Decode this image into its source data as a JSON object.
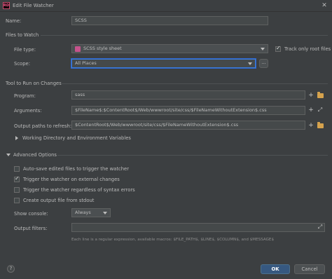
{
  "window": {
    "title": "Edit File Watcher",
    "app_icon_text": "RD"
  },
  "name": {
    "label": "Name:",
    "value": "SCSS"
  },
  "files_to_watch": {
    "section": "Files to Watch",
    "file_type_label": "File type:",
    "file_type_value": "SCSS style sheet",
    "track_only_root": {
      "label": "Track only root files",
      "checked": true
    },
    "scope_label": "Scope:",
    "scope_value": "All Places",
    "scope_more": "..."
  },
  "tool": {
    "section": "Tool to Run on Changes",
    "program_label": "Program:",
    "program_value": "sass",
    "arguments_label": "Arguments:",
    "arguments_value": "$FileName$:$ContentRoot$/Web/wwwroot/site/css/$FileNameWithoutExtension$.css",
    "output_label": "Output paths to refresh:",
    "output_value": "$ContentRoot$/Web/wwwroot/site/css/$FileNameWithoutExtension$.css",
    "working_dir_label": "Working Directory and Environment Variables"
  },
  "advanced": {
    "section": "Advanced Options",
    "options": [
      {
        "label": "Auto-save edited files to trigger the watcher",
        "checked": false
      },
      {
        "label": "Trigger the watcher on external changes",
        "checked": true
      },
      {
        "label": "Trigger the watcher regardless of syntax errors",
        "checked": false
      },
      {
        "label": "Create output file from stdout",
        "checked": false
      }
    ],
    "show_console_label": "Show console:",
    "show_console_value": "Always",
    "output_filters_label": "Output filters:",
    "output_filters_value": "",
    "hint": "Each line is a regular expression, available macros: $FILE_PATH$, $LINE$, $COLUMN$, and $MESSAGE$"
  },
  "footer": {
    "help": "?",
    "ok": "OK",
    "cancel": "Cancel"
  }
}
